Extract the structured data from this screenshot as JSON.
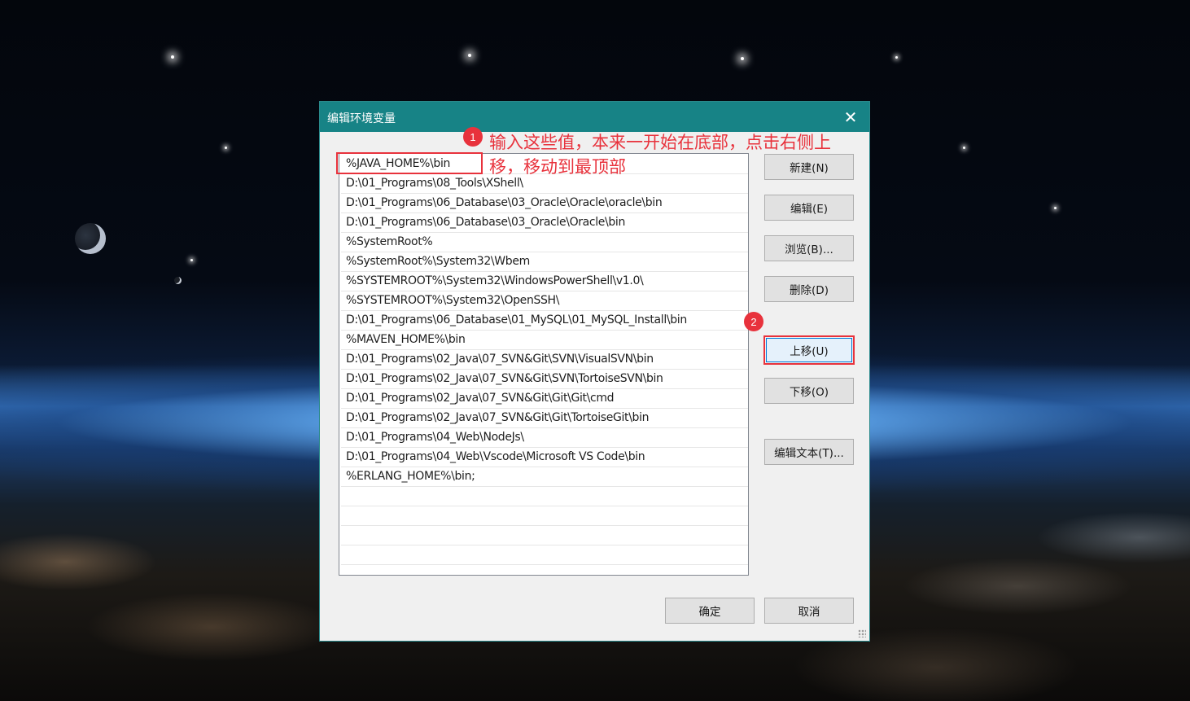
{
  "dialog": {
    "title": "编辑环境变量",
    "close_icon": "close-icon"
  },
  "paths": [
    "%JAVA_HOME%\\bin",
    "D:\\01_Programs\\08_Tools\\XShell\\",
    "D:\\01_Programs\\06_Database\\03_Oracle\\Oracle\\oracle\\bin",
    "D:\\01_Programs\\06_Database\\03_Oracle\\Oracle\\bin",
    "%SystemRoot%",
    "%SystemRoot%\\System32\\Wbem",
    "%SYSTEMROOT%\\System32\\WindowsPowerShell\\v1.0\\",
    "%SYSTEMROOT%\\System32\\OpenSSH\\",
    "D:\\01_Programs\\06_Database\\01_MySQL\\01_MySQL_Install\\bin",
    "%MAVEN_HOME%\\bin",
    "D:\\01_Programs\\02_Java\\07_SVN&Git\\SVN\\VisualSVN\\bin",
    "D:\\01_Programs\\02_Java\\07_SVN&Git\\SVN\\TortoiseSVN\\bin",
    "D:\\01_Programs\\02_Java\\07_SVN&Git\\Git\\Git\\cmd",
    "D:\\01_Programs\\02_Java\\07_SVN&Git\\Git\\TortoiseGit\\bin",
    "D:\\01_Programs\\04_Web\\NodeJs\\",
    "D:\\01_Programs\\04_Web\\Vscode\\Microsoft VS Code\\bin",
    "%ERLANG_HOME%\\bin;",
    "",
    "",
    "",
    "",
    ""
  ],
  "buttons": {
    "new": "新建(N)",
    "edit": "编辑(E)",
    "browse": "浏览(B)...",
    "delete": "删除(D)",
    "move_up": "上移(U)",
    "move_down": "下移(O)",
    "edit_text": "编辑文本(T)...",
    "ok": "确定",
    "cancel": "取消"
  },
  "annotations": {
    "badge_1": "1",
    "badge_2": "2",
    "note": "输入这些值，本来一开始在底部，点击右侧上移，移动到最顶部",
    "color": "#e8323c"
  },
  "colors": {
    "titlebar": "#178386",
    "dialog_bg": "#f0f0f0"
  }
}
